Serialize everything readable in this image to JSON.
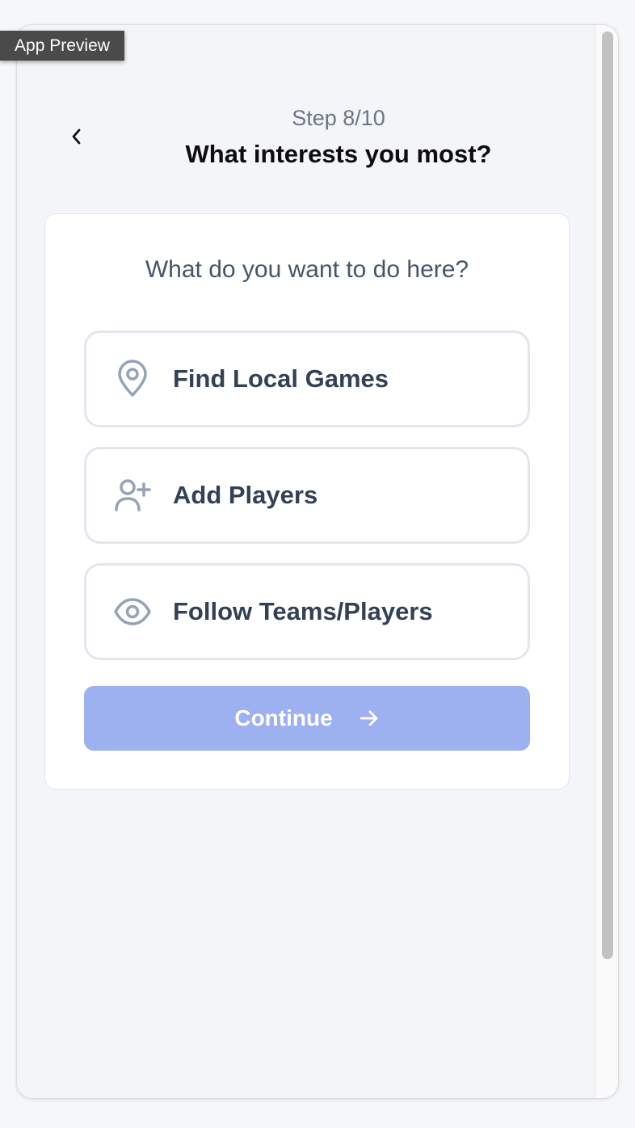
{
  "preview_tag": "App Preview",
  "header": {
    "step": "Step 8/10",
    "title": "What interests you most?"
  },
  "card": {
    "question": "What do you want to do here?",
    "options": [
      {
        "label": "Find Local Games",
        "icon": "map-pin-icon"
      },
      {
        "label": "Add Players",
        "icon": "user-plus-icon"
      },
      {
        "label": "Follow Teams/Players",
        "icon": "eye-icon"
      }
    ],
    "continue_label": "Continue",
    "continue_icon": "arrow-right-icon"
  },
  "colors": {
    "background": "#f3f5f8",
    "card": "#ffffff",
    "option_border": "#e2e7ee",
    "icon": "#94a3b8",
    "text": "#334155",
    "continue_disabled": "#9db1f0"
  }
}
